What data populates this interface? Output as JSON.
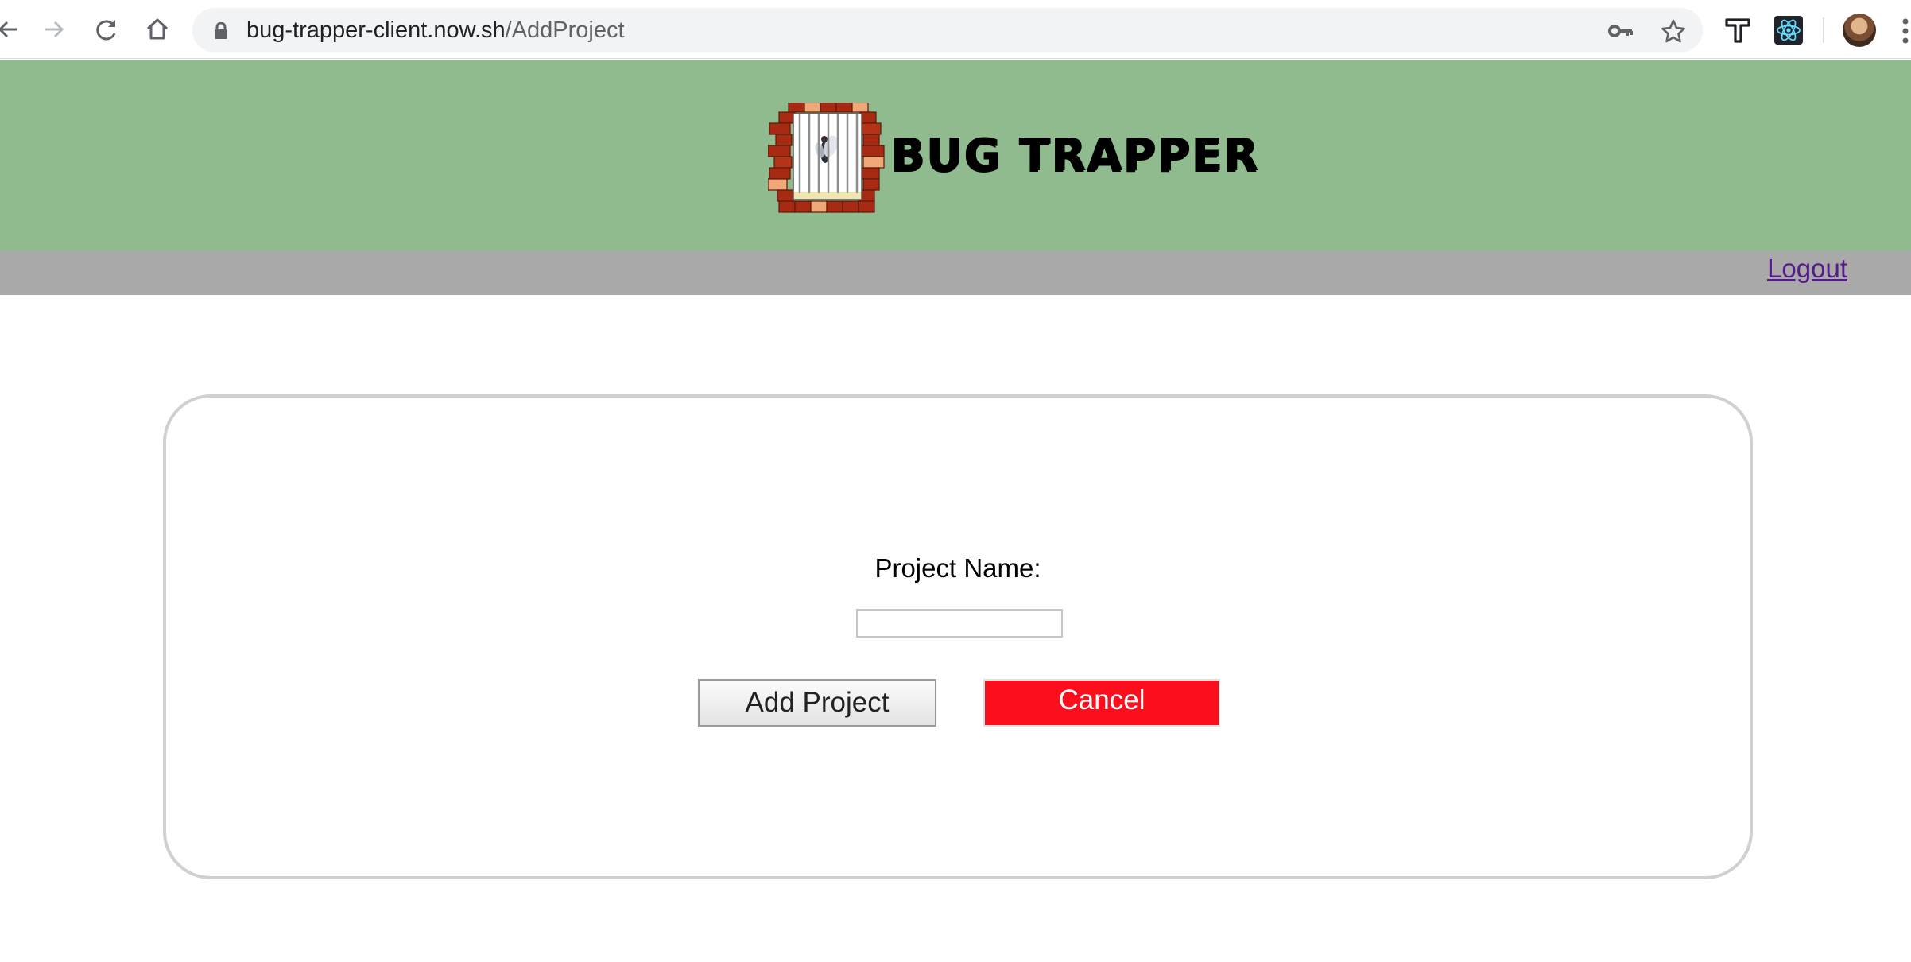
{
  "browser": {
    "url_host": "bug-trapper-client.now.sh",
    "url_path": "/AddProject",
    "icons": {
      "back": "back-arrow-icon",
      "forward": "forward-arrow-icon",
      "reload": "reload-icon",
      "home": "home-icon",
      "lock": "lock-icon",
      "key": "key-icon",
      "star": "star-icon",
      "extensions": [
        "t-extension-icon",
        "react-extension-icon"
      ],
      "profile": "avatar",
      "menu": "menu-dots-icon"
    }
  },
  "header": {
    "brand": "BUG TRAPPER",
    "background": "#8fbb8f"
  },
  "nav": {
    "logout_label": "Logout",
    "background": "#a9a9a9"
  },
  "form": {
    "project_name_label": "Project Name:",
    "project_name_value": "",
    "add_button_label": "Add Project",
    "cancel_button_label": "Cancel",
    "cancel_color": "#fc0e1d"
  }
}
